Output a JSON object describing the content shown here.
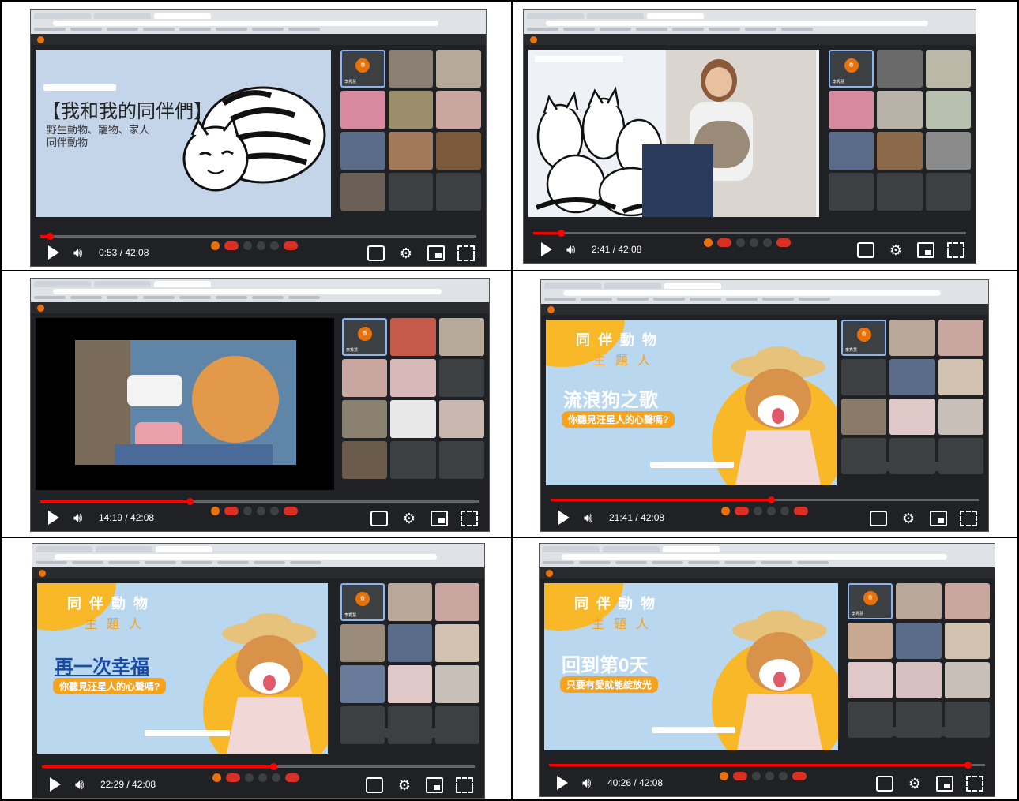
{
  "panels": [
    {
      "time": "0:53 / 42:08",
      "progress": 0.021,
      "slide_title": "【我和我的同伴們】",
      "slide_sub1": "野生動物、寵物、家人",
      "slide_sub2": "同伴動物",
      "me_label": "李秀慧"
    },
    {
      "time": "2:41 / 42:08",
      "progress": 0.064,
      "me_label": "李秀慧"
    },
    {
      "time": "14:19 / 42:08",
      "progress": 0.34,
      "me_label": "李秀慧"
    },
    {
      "time": "21:41 / 42:08",
      "progress": 0.515,
      "header1": "同伴動物",
      "header2": "主題人",
      "big_title": "流浪狗之歌",
      "subtitle": "你聽見汪星人的心聲嗎?",
      "me_label": "李秀慧"
    },
    {
      "time": "22:29 / 42:08",
      "progress": 0.534,
      "header1": "同伴動物",
      "header2": "主題人",
      "big_title": "再一次幸福",
      "subtitle": "你聽見汪星人的心聲嗎?",
      "me_label": "李秀慧"
    },
    {
      "time": "40:26 / 42:08",
      "progress": 0.96,
      "header1": "同伴動物",
      "header2": "主題人",
      "big_title": "回到第0天",
      "subtitle": "只要有愛就能綻放光",
      "me_label": "李秀慧"
    }
  ],
  "colors": {
    "youtube_red": "#ff0000",
    "meet_bg": "#202124",
    "slide_orange": "#f7a21b",
    "slide_blue": "#b9d7ee"
  }
}
